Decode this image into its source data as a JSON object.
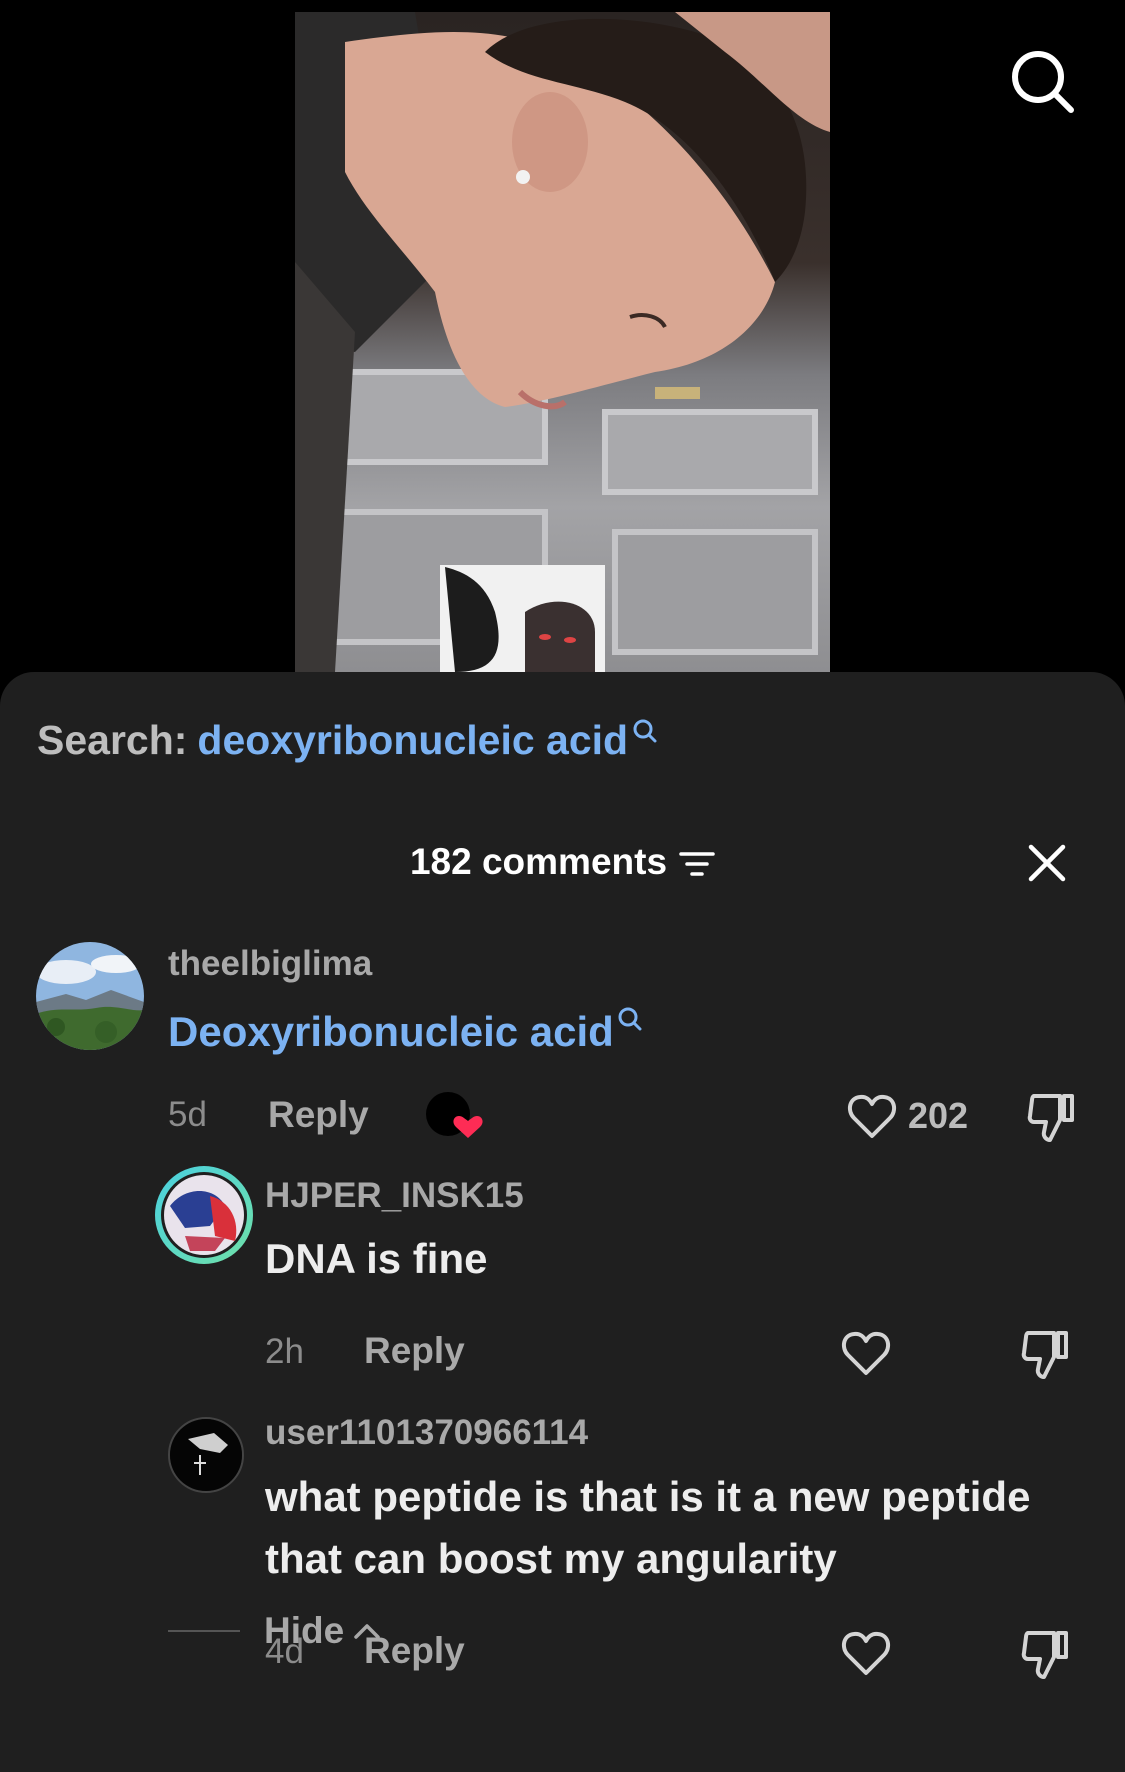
{
  "search_banner": {
    "prefix": "Search:",
    "query": "deoxyribonucleic acid"
  },
  "header": {
    "comment_count": "182 comments"
  },
  "icons": {
    "top_search": "search-icon",
    "sort": "filter-lines-icon",
    "close": "close-icon",
    "like": "heart-outline-icon",
    "dislike": "thumbs-down-icon",
    "creator_liked": "creator-liked-heart-icon",
    "hide": "chevron-up-icon"
  },
  "colors": {
    "link": "#7cb2f2",
    "sheet_bg": "#1f1f1f",
    "liked_heart": "#fe2c55"
  },
  "comments": [
    {
      "username": "theelbiglima",
      "text": "Deoxyribonucleic acid",
      "age": "5d",
      "reply_label": "Reply",
      "likes": "202"
    },
    {
      "username": "HJPER_INSK15",
      "text": "DNA is fine",
      "age": "2h",
      "reply_label": "Reply"
    },
    {
      "username": "user1101370966114",
      "text": "what peptide is that is it a new peptide that can boost my angularity",
      "age": "4d",
      "reply_label": "Reply"
    }
  ],
  "hide_label": "Hide"
}
